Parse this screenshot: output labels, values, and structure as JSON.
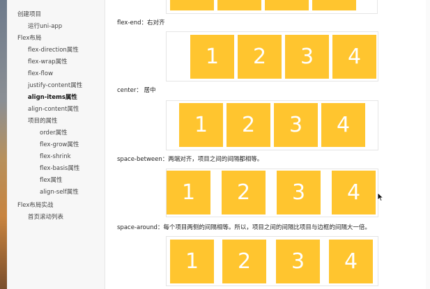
{
  "sidebar": {
    "items": [
      {
        "label": "创建项目",
        "level": 0
      },
      {
        "label": "运行uni-app",
        "level": 1
      },
      {
        "label": "Flex布局",
        "level": 0
      },
      {
        "label": "flex-direction属性",
        "level": 1
      },
      {
        "label": "flex-wrap属性",
        "level": 1
      },
      {
        "label": "flex-flow",
        "level": 1
      },
      {
        "label": "justify-content属性",
        "level": 1
      },
      {
        "label": "align-items属性",
        "level": 1,
        "active": true
      },
      {
        "label": "align-content属性",
        "level": 1
      },
      {
        "label": "项目的属性",
        "level": 1
      },
      {
        "label": "order属性",
        "level": 2
      },
      {
        "label": "flex-grow属性",
        "level": 2
      },
      {
        "label": "flex-shrink",
        "level": 2
      },
      {
        "label": "flex-basis属性",
        "level": 2
      },
      {
        "label": "flex属性",
        "level": 2
      },
      {
        "label": "align-self属性",
        "level": 2
      },
      {
        "label": "Flex布局实战",
        "level": 0
      },
      {
        "label": "首页滚动列表",
        "level": 1
      }
    ]
  },
  "content": {
    "sections": [
      {
        "caption": "flex-end：右对齐",
        "boxes": [
          "1",
          "2",
          "3",
          "4"
        ]
      },
      {
        "caption": "center： 居中",
        "boxes": [
          "1",
          "2",
          "3",
          "4"
        ]
      },
      {
        "caption": "space-between：两端对齐，项目之间的间隔都相等。",
        "boxes": [
          "1",
          "2",
          "3",
          "4"
        ]
      },
      {
        "caption": "space-around：每个项目两侧的间隔相等。所以，项目之间的间隔比项目与边框的间隔大一倍。",
        "boxes": [
          "1",
          "2",
          "3",
          "4"
        ]
      }
    ]
  },
  "colors": {
    "box_fill": "#ffc52f",
    "box_text": "#ffffff",
    "sidebar_bg": "#f7f7f7"
  },
  "icons": {
    "cursor": "mouse-pointer-icon"
  }
}
